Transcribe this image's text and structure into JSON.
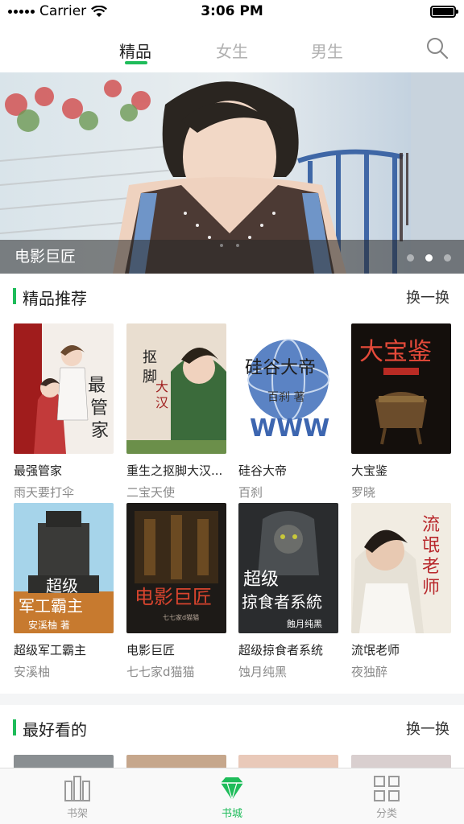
{
  "status_bar": {
    "carrier": "Carrier",
    "time": "3:06 PM"
  },
  "top_tabs": [
    {
      "label": "精品",
      "active": true
    },
    {
      "label": "女生",
      "active": false
    },
    {
      "label": "男生",
      "active": false
    }
  ],
  "banner": {
    "caption": "电影巨匠",
    "page_count": 3,
    "current_page": 2
  },
  "sections": [
    {
      "title": "精品推荐",
      "action": "换一换",
      "books": [
        {
          "title": "最强管家",
          "author": "雨天要打伞"
        },
        {
          "title": "重生之抠脚大汉...",
          "author": "二宝天使"
        },
        {
          "title": "硅谷大帝",
          "author": "百刹"
        },
        {
          "title": "大宝鉴",
          "author": "罗晓"
        },
        {
          "title": "超级军工霸主",
          "author": "安溪柚"
        },
        {
          "title": "电影巨匠",
          "author": "七七家d猫猫"
        },
        {
          "title": "超级掠食者系统",
          "author": "蚀月纯黑"
        },
        {
          "title": "流氓老师",
          "author": "夜独醉"
        }
      ]
    },
    {
      "title": "最好看的",
      "action": "换一换"
    }
  ],
  "tab_bar": [
    {
      "label": "书架",
      "icon": "bookshelf-icon",
      "active": false
    },
    {
      "label": "书城",
      "icon": "diamond-icon",
      "active": true
    },
    {
      "label": "分类",
      "icon": "grid-icon",
      "active": false
    }
  ],
  "colors": {
    "accent": "#1ebc5a",
    "inactive_text": "#9a9a9a"
  }
}
